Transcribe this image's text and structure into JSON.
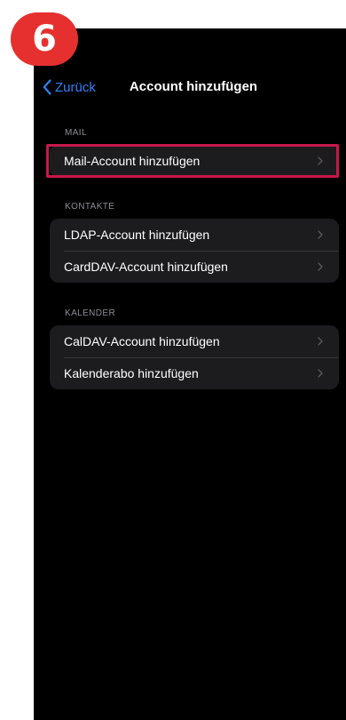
{
  "step_badge": "6",
  "nav": {
    "back_label": "Zurück",
    "title": "Account hinzufügen"
  },
  "sections": [
    {
      "header": "MAIL",
      "items": [
        {
          "label": "Mail-Account hinzufügen",
          "highlighted": true
        }
      ]
    },
    {
      "header": "KONTAKTE",
      "items": [
        {
          "label": "LDAP-Account hinzufügen"
        },
        {
          "label": "CardDAV-Account hinzufügen"
        }
      ]
    },
    {
      "header": "KALENDER",
      "items": [
        {
          "label": "CalDAV-Account hinzufügen"
        },
        {
          "label": "Kalenderabo hinzufügen"
        }
      ]
    }
  ],
  "colors": {
    "background": "#000000",
    "group_background": "#1c1c1e",
    "accent": "#2f82f6",
    "badge": "#e63030",
    "highlight": "#c8174e"
  }
}
